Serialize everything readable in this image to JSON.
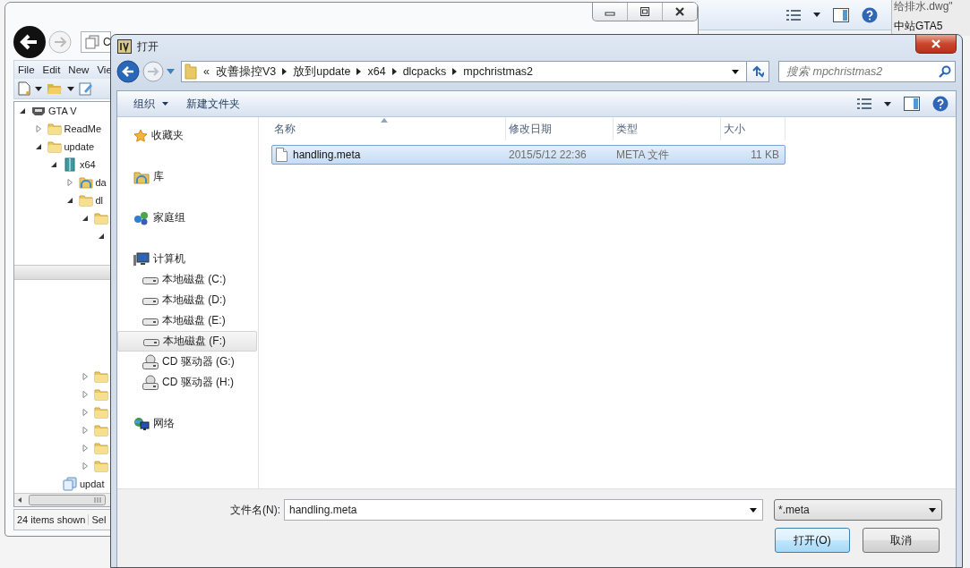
{
  "back_window": {
    "address": "C",
    "menu": [
      "File",
      "Edit",
      "New",
      "Vie"
    ],
    "tree": [
      {
        "label": "GTA V",
        "kind": "game",
        "expanded": true,
        "children": [
          {
            "label": "ReadMe",
            "kind": "folder",
            "expanded": false
          },
          {
            "label": "update",
            "kind": "folder",
            "expanded": true,
            "children": [
              {
                "label": "x64",
                "kind": "package",
                "expanded": true,
                "children": [
                  {
                    "label": "da",
                    "kind": "shared",
                    "expanded": false
                  },
                  {
                    "label": "dl",
                    "kind": "folder",
                    "expanded": true,
                    "children": [
                      {
                        "kind": "folder",
                        "expanded": true,
                        "children": [
                          {
                            "expanded": true
                          }
                        ]
                      }
                    ]
                  }
                ]
              }
            ]
          }
        ]
      }
    ],
    "tree_continued": [
      {
        "kind": "group",
        "children": [
          {
            "kind": "group",
            "children": [
              {
                "kind": "folder",
                "expanded": false
              },
              {
                "kind": "folder",
                "expanded": false
              },
              {
                "kind": "folder",
                "expanded": false
              },
              {
                "kind": "folder",
                "expanded": false
              },
              {
                "kind": "folder",
                "expanded": false
              },
              {
                "kind": "folder",
                "expanded": false
              }
            ]
          }
        ]
      },
      {
        "label": "updat",
        "kind": "archive"
      }
    ],
    "status": [
      "24 items shown",
      "Sel"
    ]
  },
  "side_window": {
    "texts": [
      "给排水.dwg\"",
      "中站GTA5"
    ]
  },
  "dialog": {
    "title": "打开",
    "breadcrumb": {
      "overflow": "«",
      "segments": [
        "改善操控V3",
        "放到update",
        "x64",
        "dlcpacks",
        "mpchristmas2"
      ]
    },
    "search": {
      "placeholder": "搜索 mpchristmas2"
    },
    "toolbar": [
      {
        "label": "组织",
        "kind": "menu"
      },
      {
        "label": "新建文件夹",
        "kind": "button"
      }
    ],
    "nav": [
      {
        "label": "收藏夹",
        "kind": "favorites",
        "selected": false
      },
      {
        "label": "库",
        "kind": "library",
        "selected": false
      },
      {
        "label": "家庭组",
        "kind": "homegroup",
        "selected": false
      },
      {
        "label": "计算机",
        "kind": "computer",
        "selected": false,
        "children": [
          {
            "label": "本地磁盘 (C:)",
            "kind": "disk",
            "selected": false
          },
          {
            "label": "本地磁盘 (D:)",
            "kind": "disk",
            "selected": false
          },
          {
            "label": "本地磁盘 (E:)",
            "kind": "disk",
            "selected": false
          },
          {
            "label": "本地磁盘 (F:)",
            "kind": "disk",
            "selected": true
          },
          {
            "label": "CD 驱动器 (G:)",
            "kind": "cd",
            "selected": false
          },
          {
            "label": "CD 驱动器 (H:)",
            "kind": "cd",
            "selected": false
          }
        ]
      },
      {
        "label": "网络",
        "kind": "network",
        "selected": false
      }
    ],
    "columns": [
      {
        "label": "名称",
        "sorted": true
      },
      {
        "label": "修改日期",
        "sorted": false
      },
      {
        "label": "类型",
        "sorted": false
      },
      {
        "label": "大小",
        "sorted": false
      }
    ],
    "rows": [
      {
        "cells": [
          "handling.meta",
          "2015/5/12 22:36",
          "META 文件",
          "11 KB"
        ],
        "selected": true
      }
    ],
    "filename": {
      "label": "文件名(N):",
      "value": "handling.meta"
    },
    "filter": {
      "value": "*.meta"
    },
    "buttons": [
      {
        "label": "打开(O)",
        "default": true
      },
      {
        "label": "取消",
        "default": false
      }
    ]
  }
}
